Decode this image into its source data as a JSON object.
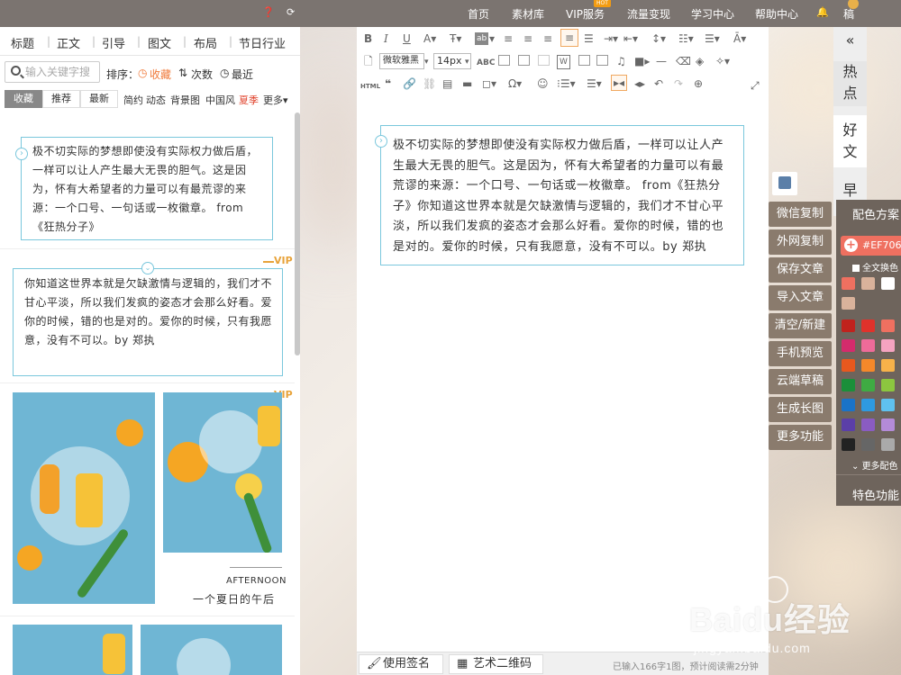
{
  "topbar": {
    "items": [
      "首页",
      "素材库",
      "VIP服务",
      "流量变现",
      "学习中心",
      "帮助中心"
    ],
    "hot": "HOT",
    "user": "稿"
  },
  "left": {
    "categories": [
      "标题",
      "正文",
      "引导",
      "图文",
      "布局",
      "节日行业"
    ],
    "search_placeholder": "输入关键字搜",
    "sort_label": "排序：",
    "sort_items": [
      "收藏",
      "次数",
      "最近"
    ],
    "filter_tabs": [
      "收藏",
      "推荐",
      "最新"
    ],
    "filter_items": [
      "简约",
      "动态",
      "背景图",
      "中国风",
      "夏季",
      "更多▾"
    ],
    "tpl1_text": "极不切实际的梦想即使没有实际权力做后盾，一样可以让人产生最大无畏的胆气。这是因为，怀有大希望者的力量可以有最荒谬的来源：一个口号、一句话或一枚徽章。 from 《狂热分子》",
    "tpl2_text": "你知道这世界本就是欠缺激情与逻辑的，我们才不甘心平淡，所以我们发疯的姿态才会那么好看。爱你的时候，错的也是对的。爱你的时候，只有我愿意，没有不可以。by 郑执",
    "vip": "VIP",
    "photo_caption_en": "AFTERNOON",
    "photo_caption_cn": "一个夏日的午后"
  },
  "editor": {
    "font": "微软雅黑",
    "size": "14px",
    "doc_text": "极不切实际的梦想即使没有实际权力做后盾，一样可以让人产生最大无畏的胆气。这是因为，怀有大希望者的力量可以有最荒谬的来源：一个口号、一句话或一枚徽章。 from《狂热分子》你知道这世界本就是欠缺激情与逻辑的，我们才不甘心平淡，所以我们发疯的姿态才会那么好看。爱你的时候，错的也是对的。爱你的时候，只有我愿意，没有不可以。by 郑执",
    "btn_signature": "使用签名",
    "btn_qr": "艺术二维码",
    "word_count": "已输入166字1图，预计阅读需2分钟",
    "html_label": "HTML",
    "abc_label": "ABC"
  },
  "side_buttons": [
    "微信复制",
    "外网复制",
    "保存文章",
    "导入文章",
    "清空/新建",
    "手机预览",
    "云端草稿",
    "生成长图",
    "更多功能"
  ],
  "rail": {
    "tabs": [
      "热点",
      "好文",
      "早"
    ],
    "collapse": "«"
  },
  "color_panel": {
    "title": "配色方案",
    "hex": "#EF7060",
    "whole_text": "全文换色",
    "more": "更多配色",
    "feature": "特色功能",
    "colors": {
      "row1": [
        "#ef7060",
        "#d9b29b",
        "#ffffff",
        "#ef7060"
      ],
      "row2": [
        "#d9b29b"
      ],
      "grid": [
        [
          "#c0221d",
          "#e0322b",
          "#ef7060",
          "#f7c3bd"
        ],
        [
          "#d42b6c",
          "#ee6b99",
          "#f5a3c0",
          "#f9d3e0"
        ],
        [
          "#e8581e",
          "#f5882a",
          "#f7b24a",
          "#fad38b"
        ],
        [
          "#1b8f3a",
          "#3fab43",
          "#8cc63f",
          "#c9e27a"
        ],
        [
          "#1a73c8",
          "#2e9ae0",
          "#5fc1ef",
          "#a8def5"
        ],
        [
          "#5b3fa8",
          "#8a5cc2",
          "#b48bd8",
          "#d9c3ee"
        ],
        [
          "#222222",
          "#666666",
          "#aaaaaa",
          "#dddddd"
        ]
      ]
    }
  },
  "watermark": {
    "main": "Baidu经验",
    "sub": "jingyan.baidu.com"
  }
}
